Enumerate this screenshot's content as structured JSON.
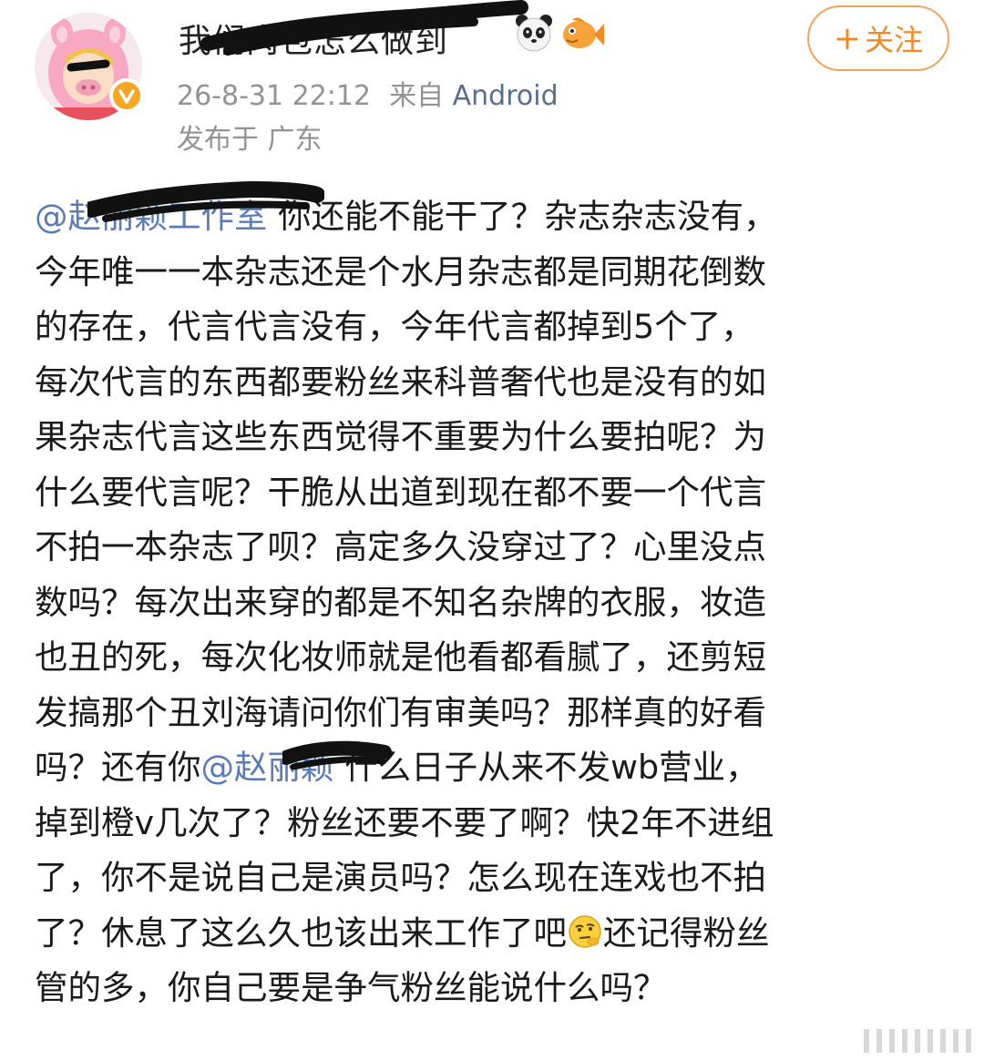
{
  "header": {
    "username": "我们肉包怎么做到",
    "timestamp": "26-8-31 22:12",
    "source_prefix": "来自",
    "source": "Android",
    "location": "发布于 广东",
    "follow_label": "关注",
    "follow_plus": "+",
    "avatar_icon": "pig-hood-avatar-icon",
    "verified_icon": "verified-badge-icon",
    "username_emojis": [
      "panda-icon",
      "goldfish-icon"
    ]
  },
  "post": {
    "lines": [
      [
        {
          "t": "m",
          "v": "@赵丽颖工作室"
        },
        {
          "t": "x",
          "v": " 你还能不能干了？杂志杂志没有，"
        }
      ],
      [
        {
          "t": "x",
          "v": "今年唯一一本杂志还是个水月杂志都是同期花倒数"
        }
      ],
      [
        {
          "t": "x",
          "v": "的存在，代言代言没有，今年代言都掉到5个了，"
        }
      ],
      [
        {
          "t": "x",
          "v": "每次代言的东西都要粉丝来科普奢代也是没有的如"
        }
      ],
      [
        {
          "t": "x",
          "v": "果杂志代言这些东西觉得不重要为什么要拍呢？为"
        }
      ],
      [
        {
          "t": "x",
          "v": "什么要代言呢？干脆从出道到现在都不要一个代言"
        }
      ],
      [
        {
          "t": "x",
          "v": "不拍一本杂志了呗？高定多久没穿过了？心里没点"
        }
      ],
      [
        {
          "t": "x",
          "v": "数吗？每次出来穿的都是不知名杂牌的衣服，妆造"
        }
      ],
      [
        {
          "t": "x",
          "v": "也丑的死，每次化妆师就是他看都看腻了，还剪短"
        }
      ],
      [
        {
          "t": "x",
          "v": "发搞那个丑刘海请问你们有审美吗？那样真的好看"
        }
      ],
      [
        {
          "t": "x",
          "v": "吗？还有你"
        },
        {
          "t": "m",
          "v": "@赵丽颖"
        },
        {
          "t": "x",
          "v": " 什么日子从来不发wb营业，"
        }
      ],
      [
        {
          "t": "x",
          "v": "掉到橙v几次了？粉丝还要不要了啊？快2年不进组"
        }
      ],
      [
        {
          "t": "x",
          "v": "了，你不是说自己是演员吗？怎么现在连戏也不拍"
        }
      ],
      [
        {
          "t": "x",
          "v": "了？休息了这么久也该出来工作了吧"
        },
        {
          "t": "e",
          "v": "thinking-face-icon"
        },
        {
          "t": "x",
          "v": "还记得粉丝"
        }
      ],
      [
        {
          "t": "x",
          "v": "管的多，你自己要是争气粉丝能说什么吗？"
        }
      ]
    ]
  },
  "colors": {
    "mention": "#5a7bb6",
    "meta": "#939393",
    "follow": "#f08a24",
    "verified": "#f5a623"
  }
}
